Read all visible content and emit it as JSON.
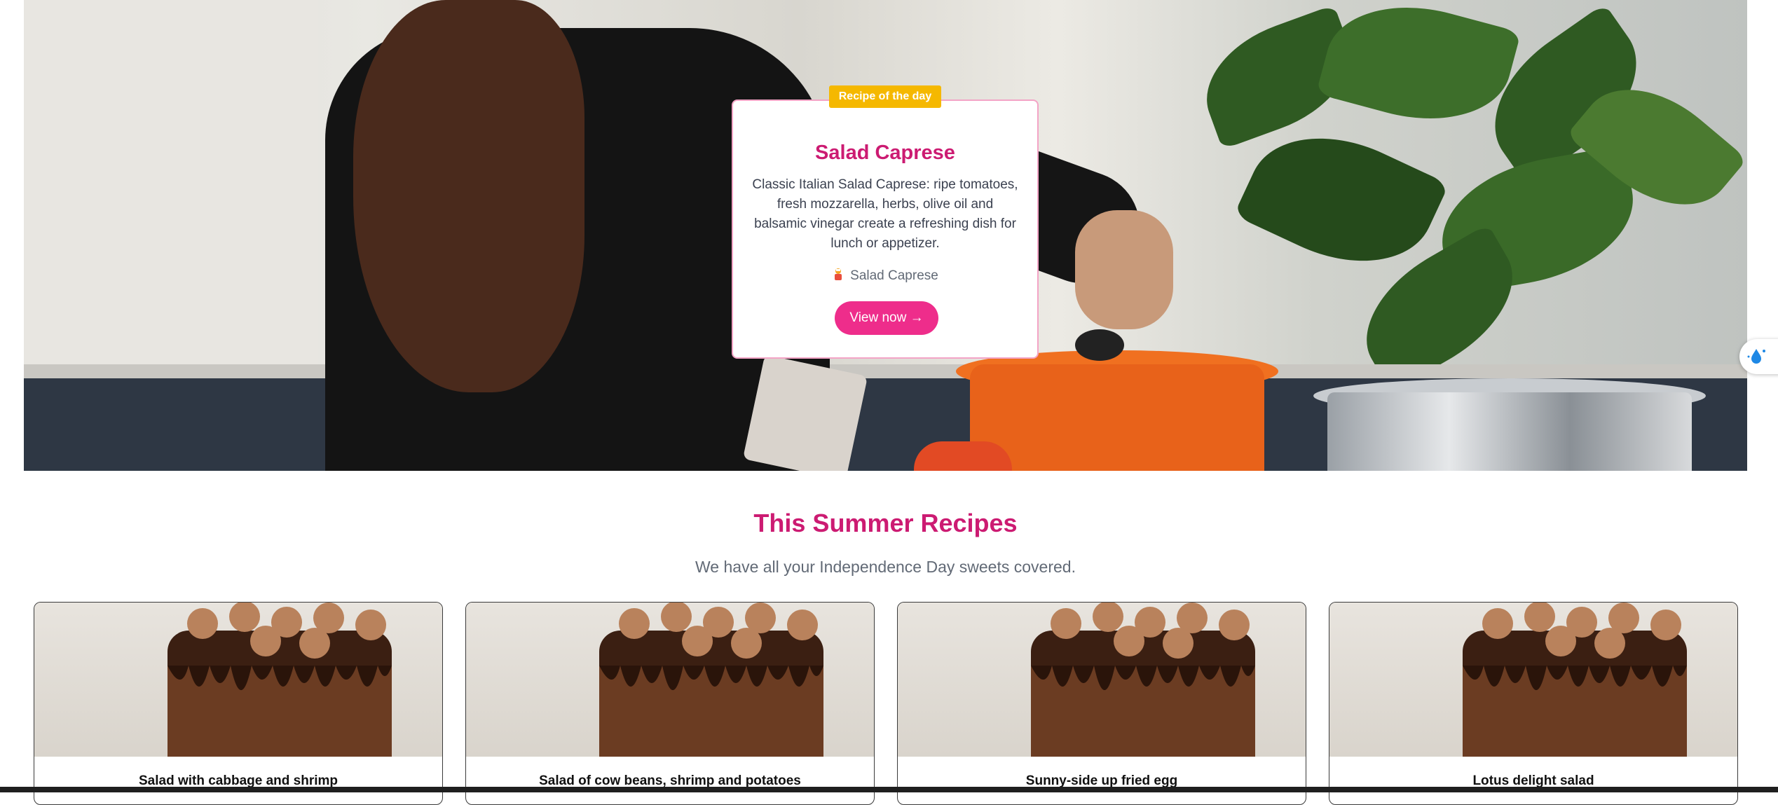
{
  "hero": {
    "badge": "Recipe of the day",
    "title": "Salad Caprese",
    "description": "Classic Italian Salad Caprese: ripe tomatoes, fresh mozzarella, herbs, olive oil and balsamic vinegar create a refreshing dish for lunch or appetizer.",
    "meta": "Salad Caprese",
    "cta": "View now →"
  },
  "section": {
    "title": "This Summer Recipes",
    "subtitle": "We have all your Independence Day sweets covered."
  },
  "recipes": [
    {
      "title": "Salad with cabbage and shrimp"
    },
    {
      "title": "Salad of cow beans, shrimp and potatoes"
    },
    {
      "title": "Sunny-side up fried egg"
    },
    {
      "title": "Lotus delight salad"
    }
  ],
  "colors": {
    "accent": "#cc1b72",
    "button": "#ee2d8b",
    "badge": "#f5b800",
    "card_border": "#f3a4c6"
  },
  "icons": {
    "meta_icon": "chef-icon",
    "side_widget": "water-drop-icon"
  }
}
